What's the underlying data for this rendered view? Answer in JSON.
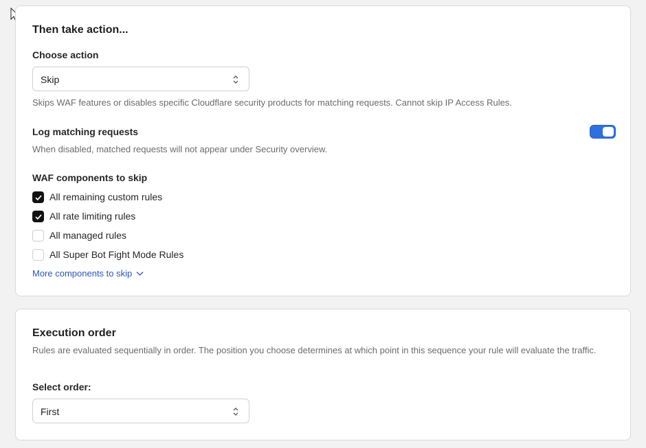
{
  "action_card": {
    "title": "Then take action...",
    "choose_action_label": "Choose action",
    "action_value": "Skip",
    "action_help": "Skips WAF features or disables specific Cloudflare security products for matching requests. Cannot skip IP Access Rules.",
    "log_label": "Log matching requests",
    "log_help": "When disabled, matched requests will not appear under Security overview.",
    "log_enabled": true,
    "components_label": "WAF components to skip",
    "components": [
      {
        "label": "All remaining custom rules",
        "checked": true
      },
      {
        "label": "All rate limiting rules",
        "checked": true
      },
      {
        "label": "All managed rules",
        "checked": false
      },
      {
        "label": "All Super Bot Fight Mode Rules",
        "checked": false
      }
    ],
    "more_link": "More components to skip"
  },
  "order_card": {
    "title": "Execution order",
    "help": "Rules are evaluated sequentially in order. The position you choose determines at which point in this sequence your rule will evaluate the traffic.",
    "select_label": "Select order:",
    "order_value": "First"
  },
  "colors": {
    "accent": "#2f6fe0",
    "link": "#2a56b8",
    "checkbox_checked": "#111111"
  }
}
